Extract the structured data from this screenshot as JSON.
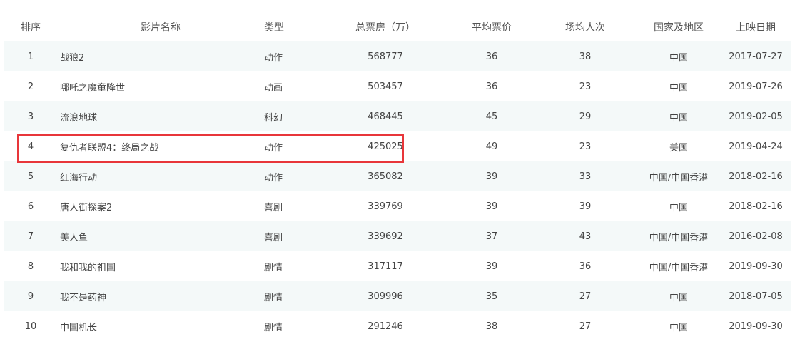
{
  "table": {
    "headers": [
      "排序",
      "影片名称",
      "类型",
      "总票房（万）",
      "平均票价",
      "场均人次",
      "国家及地区",
      "上映日期"
    ],
    "rows": [
      [
        "1",
        "战狼2",
        "动作",
        "568777",
        "36",
        "38",
        "中国",
        "2017-07-27"
      ],
      [
        "2",
        "哪吒之魔童降世",
        "动画",
        "503457",
        "36",
        "23",
        "中国",
        "2019-07-26"
      ],
      [
        "3",
        "流浪地球",
        "科幻",
        "468445",
        "45",
        "29",
        "中国",
        "2019-02-05"
      ],
      [
        "4",
        "复仇者联盟4：终局之战",
        "动作",
        "425025",
        "49",
        "23",
        "美国",
        "2019-04-24"
      ],
      [
        "5",
        "红海行动",
        "动作",
        "365082",
        "39",
        "33",
        "中国/中国香港",
        "2018-02-16"
      ],
      [
        "6",
        "唐人街探案2",
        "喜剧",
        "339769",
        "39",
        "39",
        "中国",
        "2018-02-16"
      ],
      [
        "7",
        "美人鱼",
        "喜剧",
        "339692",
        "37",
        "43",
        "中国/中国香港",
        "2016-02-08"
      ],
      [
        "8",
        "我和我的祖国",
        "剧情",
        "317117",
        "39",
        "36",
        "中国/中国香港",
        "2019-09-30"
      ],
      [
        "9",
        "我不是药神",
        "剧情",
        "309996",
        "35",
        "27",
        "中国",
        "2018-07-05"
      ],
      [
        "10",
        "中国机长",
        "剧情",
        "291246",
        "38",
        "27",
        "中国",
        "2019-09-30"
      ]
    ]
  },
  "highlight": {
    "row": 4,
    "color": "#e8363a"
  },
  "colors": {
    "stripe": "#f4f9f9",
    "text": "#444444",
    "header_text": "#555555"
  }
}
